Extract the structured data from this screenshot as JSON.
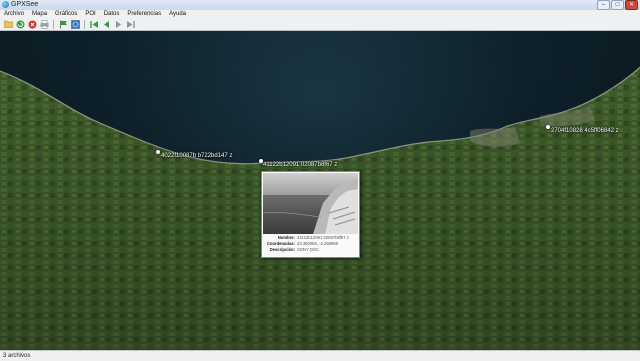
{
  "window": {
    "title": "GPXSee"
  },
  "menu": [
    "Archivo",
    "Mapa",
    "Gráficos",
    "POI",
    "Datos",
    "Preferencias",
    "Ayuda"
  ],
  "toolbar": {
    "icons": [
      "open-file-icon",
      "reload-icon",
      "close-file-icon",
      "print-icon",
      "flag-icon",
      "globe-icon",
      "first-icon",
      "previous-icon",
      "next-icon",
      "last-icon"
    ]
  },
  "map": {
    "pins": [
      {
        "label": "4022f10087b b722bd147 z"
      },
      {
        "label": "41122b12091 02087b8f67 z"
      },
      {
        "label": "2704f10828 4c5ff06842 z"
      }
    ]
  },
  "popup": {
    "rows": [
      {
        "key": "Nombre:",
        "value": "41122b12091 02087b8f67 z"
      },
      {
        "key": "Coordenadas:",
        "value": "43.360056, -2.268969"
      },
      {
        "key": "Descripción:",
        "value": "SONY DSC"
      }
    ]
  },
  "status": {
    "text": "3 archivos"
  },
  "colors": {
    "sea": "#0e222c",
    "land": "#3d5a2b",
    "pin": "#ffffff"
  }
}
